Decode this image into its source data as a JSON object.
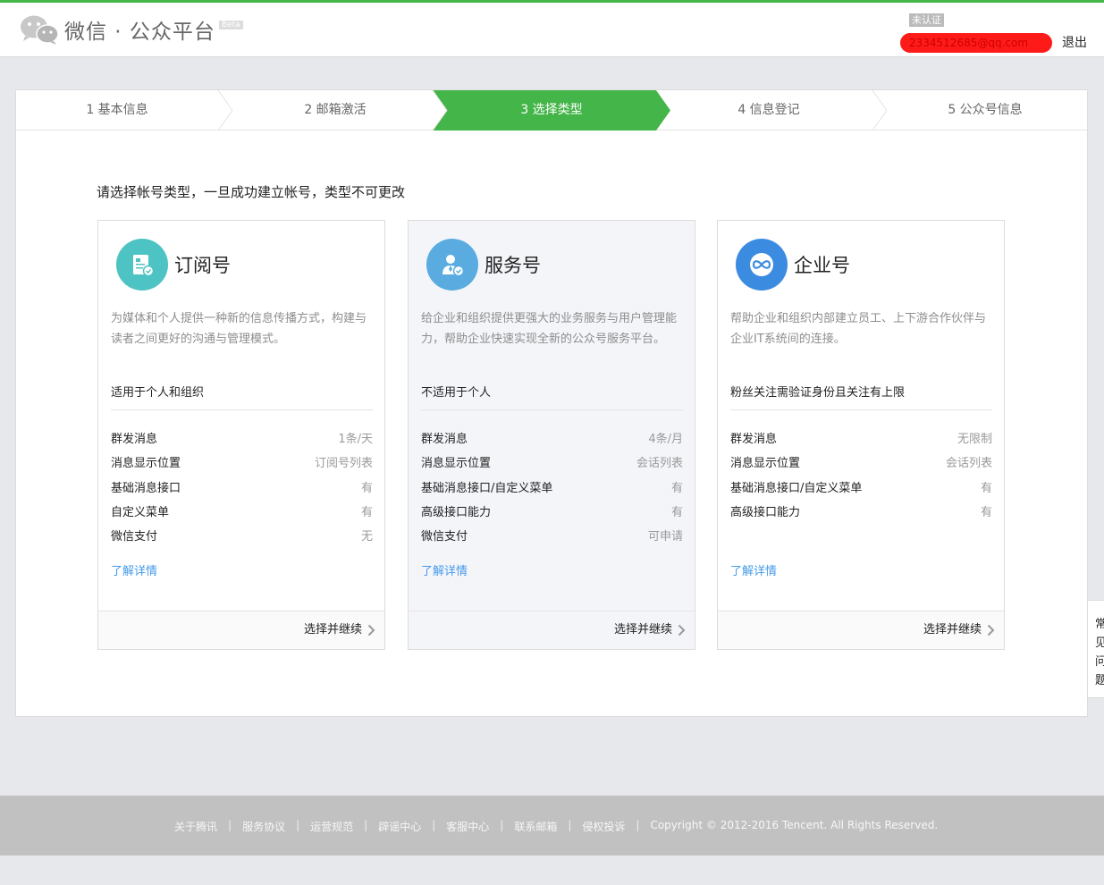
{
  "header": {
    "logo_text": "微信 · 公众平台",
    "beta": "Beta",
    "unverified": "未认证",
    "account": "2334512685@qq.com",
    "logout": "退出"
  },
  "steps": [
    "1 基本信息",
    "2 邮箱激活",
    "3 选择类型",
    "4 信息登记",
    "5 公众号信息"
  ],
  "active_step": 3,
  "prompt": "请选择帐号类型，一旦成功建立帐号，类型不可更改",
  "cards": [
    {
      "title": "订阅号",
      "icon": "subscription-doc-icon",
      "icon_color": "#4ec3c4",
      "description": "为媒体和个人提供一种新的信息传播方式，构建与读者之间更好的沟通与管理模式。",
      "suitable": "适用于个人和组织",
      "features": [
        {
          "k": "群发消息",
          "v": "1条/天"
        },
        {
          "k": "消息显示位置",
          "v": "订阅号列表"
        },
        {
          "k": "基础消息接口",
          "v": "有"
        },
        {
          "k": "自定义菜单",
          "v": "有"
        },
        {
          "k": "微信支付",
          "v": "无"
        }
      ],
      "more": "了解详情",
      "select": "选择并继续"
    },
    {
      "title": "服务号",
      "icon": "service-person-icon",
      "icon_color": "#5aace0",
      "description": "给企业和组织提供更强大的业务服务与用户管理能力，帮助企业快速实现全新的公众号服务平台。",
      "suitable": "不适用于个人",
      "features": [
        {
          "k": "群发消息",
          "v": "4条/月"
        },
        {
          "k": "消息显示位置",
          "v": "会话列表"
        },
        {
          "k": "基础消息接口/自定义菜单",
          "v": "有"
        },
        {
          "k": "高级接口能力",
          "v": "有"
        },
        {
          "k": "微信支付",
          "v": "可申请"
        }
      ],
      "more": "了解详情",
      "select": "选择并继续"
    },
    {
      "title": "企业号",
      "icon": "enterprise-infinity-icon",
      "icon_color": "#3b8ce0",
      "description": "帮助企业和组织内部建立员工、上下游合作伙伴与企业IT系统间的连接。",
      "suitable": "粉丝关注需验证身份且关注有上限",
      "features": [
        {
          "k": "群发消息",
          "v": "无限制"
        },
        {
          "k": "消息显示位置",
          "v": "会话列表"
        },
        {
          "k": "基础消息接口/自定义菜单",
          "v": "有"
        },
        {
          "k": "高级接口能力",
          "v": "有"
        }
      ],
      "more": "了解详情",
      "select": "选择并继续"
    }
  ],
  "faq": "常见问题",
  "footer": {
    "links": [
      "关于腾讯",
      "服务协议",
      "运营规范",
      "辟谣中心",
      "客服中心",
      "联系邮箱",
      "侵权投诉"
    ],
    "copyright": "Copyright © 2012-2016 Tencent. All Rights Reserved."
  },
  "colors": {
    "brand_green": "#44b549",
    "link_blue": "#459ae9"
  }
}
